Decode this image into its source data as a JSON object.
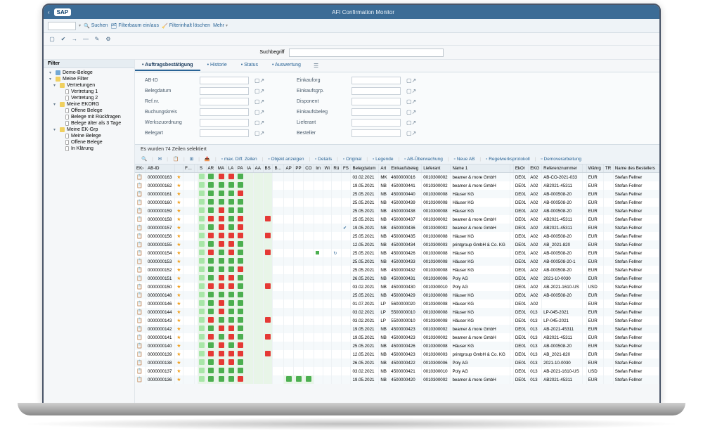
{
  "header": {
    "back": "‹",
    "logo": "SAP",
    "title": "AFI Confirmation Monitor"
  },
  "toolbar": {
    "suchen": "Suchen",
    "filterbaum": "Filterbaum ein/aus",
    "filterinhalt": "Filterinhalt löschen",
    "mehr": "Mehr"
  },
  "search": {
    "label": "Suchbegriff",
    "placeholder": ""
  },
  "sidebar": {
    "title": "Filter",
    "nodes": [
      {
        "l": 0,
        "exp": "▾",
        "t": "Demo-Belege",
        "ico": "blue"
      },
      {
        "l": 0,
        "exp": "▾",
        "t": "Meine Filter",
        "ico": "fld"
      },
      {
        "l": 1,
        "exp": "▾",
        "t": "Vertretungen",
        "ico": "fld"
      },
      {
        "l": 2,
        "exp": "",
        "t": "Vertretung 1",
        "ico": "doc"
      },
      {
        "l": 2,
        "exp": "",
        "t": "Vertretung 2",
        "ico": "doc"
      },
      {
        "l": 1,
        "exp": "▾",
        "t": "Meine EKORG",
        "ico": "fld"
      },
      {
        "l": 2,
        "exp": "",
        "t": "Offene Belege",
        "ico": "doc"
      },
      {
        "l": 2,
        "exp": "",
        "t": "Belege mit Rückfragen",
        "ico": "doc"
      },
      {
        "l": 2,
        "exp": "",
        "t": "Belege älter als 3 Tage",
        "ico": "doc"
      },
      {
        "l": 1,
        "exp": "▾",
        "t": "Meine EK-Grp",
        "ico": "fld"
      },
      {
        "l": 2,
        "exp": "",
        "t": "Meine Belege",
        "ico": "doc"
      },
      {
        "l": 2,
        "exp": "",
        "t": "Offene Belege",
        "ico": "doc"
      },
      {
        "l": 2,
        "exp": "",
        "t": "In Klärung",
        "ico": "doc"
      }
    ]
  },
  "tabs": [
    {
      "label": "Auftragsbestätigung",
      "active": true
    },
    {
      "label": "Historie"
    },
    {
      "label": "Status"
    },
    {
      "label": "Auswertung"
    }
  ],
  "filterForm": {
    "left": [
      {
        "label": "AB-ID"
      },
      {
        "label": "Belegdatum"
      },
      {
        "label": "Ref.nr."
      },
      {
        "label": "Buchungskreis"
      },
      {
        "label": "Werkszuordnung"
      },
      {
        "label": "Belegart"
      }
    ],
    "right": [
      {
        "label": "Einkauforg"
      },
      {
        "label": "Einkaufsgrp."
      },
      {
        "label": "Disponent"
      },
      {
        "label": "Einkaufsbeleg"
      },
      {
        "label": "Lieferant"
      },
      {
        "label": "Besteller"
      }
    ]
  },
  "grid": {
    "info": "Es wurden 74 Zeilen selektiert",
    "toolbarBtns": [
      "🔍",
      "✉",
      "📋",
      "⊞",
      "📤",
      "max. Diff. Zeilen",
      "Objekt anzeigen",
      "Details",
      "Original",
      "Legende",
      "AB-Überwachung",
      "Neue AB",
      "Regelwerksprotokoll",
      "Demoverarbeitung"
    ],
    "cols": [
      "EK›",
      "AB-ID",
      "",
      "F…",
      "",
      "S",
      "AR",
      "MA",
      "LA",
      "PA",
      "IA",
      "AA",
      "BS",
      "B…",
      "AP",
      "PP",
      "CO",
      "Im",
      "Wi",
      "Rü",
      "FS",
      "Belegdatum",
      "Art",
      "Einkaufsbeleg",
      "Lieferant",
      "Name 1",
      "",
      "EkOr",
      "EKG",
      "Referenznummer",
      "",
      "Währg",
      "TR",
      "Name des Bestellers"
    ],
    "rows": [
      {
        "id": "0000000163",
        "dat": "03.02.2021",
        "art": "MK",
        "eb": "4600000016",
        "lf": "0010300002",
        "n1": "beamer & more GmbH",
        "eo": "DE01",
        "eg": "A02",
        "ref": "AB-CO-2021-033",
        "w": "EUR",
        "bst": "Stefan Fellner",
        "p": "grrg"
      },
      {
        "id": "0000000162",
        "dat": "19.05.2021",
        "art": "NB",
        "eb": "4500000441",
        "lf": "0010300002",
        "n1": "beamer & more GmbH",
        "eo": "DE01",
        "eg": "A02",
        "ref": "AB2021-45311",
        "w": "EUR",
        "bst": "Stefan Fellner",
        "p": "gggg"
      },
      {
        "id": "0000000161",
        "dat": "25.05.2021",
        "art": "NB",
        "eb": "4500000440",
        "lf": "0010300008",
        "n1": "Häuser KG",
        "eo": "DE01",
        "eg": "A02",
        "ref": "AB-000508-20",
        "w": "EUR",
        "bst": "Stefan Fellner",
        "p": "gggr"
      },
      {
        "id": "0000000160",
        "dat": "25.05.2021",
        "art": "NB",
        "eb": "4500000439",
        "lf": "0010300008",
        "n1": "Häuser KG",
        "eo": "DE01",
        "eg": "A02",
        "ref": "AB-000508-20",
        "w": "EUR",
        "bst": "Stefan Fellner",
        "p": "gggg"
      },
      {
        "id": "0000000159",
        "dat": "25.05.2021",
        "art": "NB",
        "eb": "4500000438",
        "lf": "0010300008",
        "n1": "Häuser KG",
        "eo": "DE01",
        "eg": "A02",
        "ref": "AB-000508-20",
        "w": "EUR",
        "bst": "Stefan Fellner",
        "p": "grgg"
      },
      {
        "id": "0000000158",
        "dat": "25.05.2021",
        "art": "NB",
        "eb": "4500000437",
        "lf": "0010300002",
        "n1": "beamer & more GmbH",
        "eo": "DE01",
        "eg": "A02",
        "ref": "AB2021-45311",
        "w": "EUR",
        "bst": "Stefan Fellner",
        "p": "rrgr"
      },
      {
        "id": "0000000157",
        "dat": "19.05.2021",
        "art": "NB",
        "eb": "4500000436",
        "lf": "0010300002",
        "n1": "beamer & more GmbH",
        "eo": "DE01",
        "eg": "A02",
        "ref": "AB2021-45311",
        "w": "EUR",
        "bst": "Stefan Fellner",
        "p": "grgr",
        "fs": true
      },
      {
        "id": "0000000156",
        "dat": "25.05.2021",
        "art": "NB",
        "eb": "4500000435",
        "lf": "0010300008",
        "n1": "Häuser KG",
        "eo": "DE01",
        "eg": "A02",
        "ref": "AB-000508-20",
        "w": "EUR",
        "bst": "Stefan Fellner",
        "p": "rrrr"
      },
      {
        "id": "0000000155",
        "dat": "12.05.2021",
        "art": "NB",
        "eb": "4500000434",
        "lf": "0010300003",
        "n1": "printgroup GmbH & Co. KG",
        "eo": "DE01",
        "eg": "A02",
        "ref": "AB_2021-820",
        "w": "EUR",
        "bst": "Stefan Fellner",
        "p": "grrg"
      },
      {
        "id": "0000000154",
        "dat": "25.05.2021",
        "art": "NB",
        "eb": "4500000426",
        "lf": "0010300008",
        "n1": "Häuser KG",
        "eo": "DE01",
        "eg": "A02",
        "ref": "AB-000508-20",
        "w": "EUR",
        "bst": "Stefan Fellner",
        "p": "rgrg",
        "im": true
      },
      {
        "id": "0000000153",
        "dat": "25.05.2021",
        "art": "NB",
        "eb": "4500000433",
        "lf": "0010300008",
        "n1": "Häuser KG",
        "eo": "DE01",
        "eg": "A02",
        "ref": "AB-000508-20-1",
        "w": "EUR",
        "bst": "Stefan Fellner",
        "p": "gggg"
      },
      {
        "id": "0000000152",
        "dat": "25.05.2021",
        "art": "NB",
        "eb": "4500000432",
        "lf": "0010300008",
        "n1": "Häuser KG",
        "eo": "DE01",
        "eg": "A02",
        "ref": "AB-000508-20",
        "w": "EUR",
        "bst": "Stefan Fellner",
        "p": "gggr"
      },
      {
        "id": "0000000151",
        "dat": "26.05.2021",
        "art": "NB",
        "eb": "4500000431",
        "lf": "0010300006",
        "n1": "Poly AG",
        "eo": "DE01",
        "eg": "A02",
        "ref": "2021-10-0030",
        "w": "EUR",
        "bst": "Stefan Fellner",
        "p": "grrg"
      },
      {
        "id": "0000000150",
        "dat": "03.02.2021",
        "art": "NB",
        "eb": "4500000430",
        "lf": "0010300010",
        "n1": "Poly AG",
        "eo": "DE01",
        "eg": "A02",
        "ref": "AB-2021-1610-US",
        "w": "USD",
        "bst": "Stefan Fellner",
        "p": "rrrg"
      },
      {
        "id": "0000000148",
        "dat": "25.05.2021",
        "art": "NB",
        "eb": "4500000429",
        "lf": "0010300008",
        "n1": "Häuser KG",
        "eo": "DE01",
        "eg": "A02",
        "ref": "AB-000508-20",
        "w": "EUR",
        "bst": "Stefan Fellner",
        "p": "gggg"
      },
      {
        "id": "0000000146",
        "dat": "01.07.2021",
        "art": "LP",
        "eb": "5600000020",
        "lf": "0010300008",
        "n1": "Häuser KG",
        "eo": "DE01",
        "eg": "A02",
        "ref": "",
        "w": "EUR",
        "bst": "Stefan Fellner",
        "p": "grgg"
      },
      {
        "id": "0000000144",
        "dat": "03.02.2021",
        "art": "LP",
        "eb": "5500000010",
        "lf": "0010300008",
        "n1": "Häuser KG",
        "eo": "DE01",
        "eg": "013",
        "ref": "LP-045-2021",
        "w": "EUR",
        "bst": "Stefan Fellner",
        "p": "grgg"
      },
      {
        "id": "0000000143",
        "dat": "03.02.2021",
        "art": "LP",
        "eb": "5500000010",
        "lf": "0010300008",
        "n1": "Häuser KG",
        "eo": "DE01",
        "eg": "013",
        "ref": "LP-045-2021",
        "w": "EUR",
        "bst": "Stefan Fellner",
        "p": "rggg"
      },
      {
        "id": "0000000142",
        "dat": "19.05.2021",
        "art": "NB",
        "eb": "4500000423",
        "lf": "0010300002",
        "n1": "beamer & more GmbH",
        "eo": "DE01",
        "eg": "013",
        "ref": "AB-2021-45311",
        "w": "EUR",
        "bst": "Stefan Fellner",
        "p": "grrg"
      },
      {
        "id": "0000000141",
        "dat": "19.05.2021",
        "art": "NB",
        "eb": "4500000423",
        "lf": "0010300002",
        "n1": "beamer & more GmbH",
        "eo": "DE01",
        "eg": "013",
        "ref": "AB2021-45311",
        "w": "EUR",
        "bst": "Stefan Fellner",
        "p": "rgrg"
      },
      {
        "id": "0000000140",
        "dat": "25.05.2021",
        "art": "NB",
        "eb": "4500000426",
        "lf": "0010300008",
        "n1": "Häuser KG",
        "eo": "DE01",
        "eg": "013",
        "ref": "AB-000508-20",
        "w": "EUR",
        "bst": "Stefan Fellner",
        "p": "grgr"
      },
      {
        "id": "0000000139",
        "dat": "12.05.2021",
        "art": "NB",
        "eb": "4500000423",
        "lf": "0010300003",
        "n1": "printgroup GmbH & Co. KG",
        "eo": "DE01",
        "eg": "013",
        "ref": "AB_2021-820",
        "w": "EUR",
        "bst": "Stefan Fellner",
        "p": "rrrr"
      },
      {
        "id": "0000000138",
        "dat": "26.05.2021",
        "art": "NB",
        "eb": "4500000422",
        "lf": "0010300006",
        "n1": "Poly AG",
        "eo": "DE01",
        "eg": "013",
        "ref": "2021-10-0030",
        "w": "EUR",
        "bst": "Stefan Fellner",
        "p": "grrg"
      },
      {
        "id": "0000000137",
        "dat": "03.02.2021",
        "art": "NB",
        "eb": "4500000421",
        "lf": "0010300010",
        "n1": "Poly AG",
        "eo": "DE01",
        "eg": "013",
        "ref": "AB-2021-1610-US",
        "w": "USD",
        "bst": "Stefan Fellner",
        "p": "gggg"
      },
      {
        "id": "0000000136",
        "dat": "19.05.2021",
        "art": "NB",
        "eb": "4500000420",
        "lf": "0010300002",
        "n1": "beamer & more GmbH",
        "eo": "DE01",
        "eg": "013",
        "ref": "AB2021-45311",
        "w": "EUR",
        "bst": "Stefan Fellner",
        "p": "gggr",
        "apx": true
      }
    ]
  }
}
